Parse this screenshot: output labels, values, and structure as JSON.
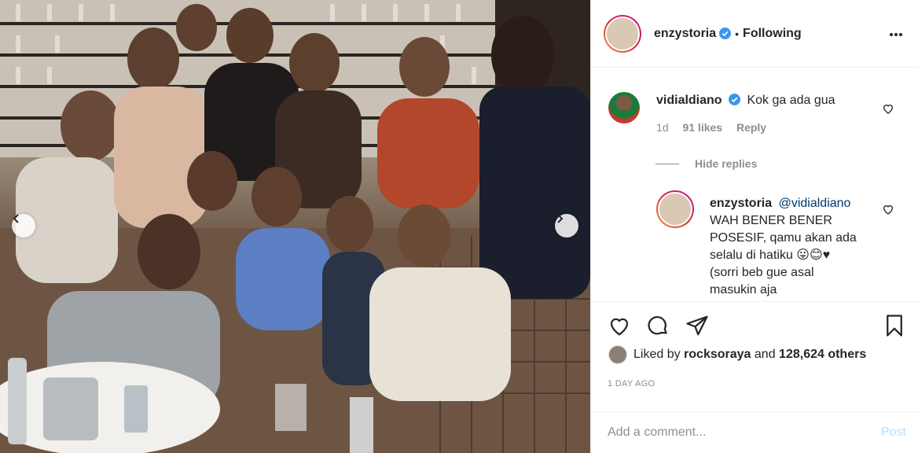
{
  "post": {
    "author": "enzystoria",
    "follow_state": "Following",
    "dot": "•"
  },
  "comments": [
    {
      "user": "vidialdiano",
      "text": "Kok ga ada gua",
      "age": "1d",
      "likes": "91 likes",
      "reply_label": "Reply"
    }
  ],
  "hide_replies_label": "Hide replies",
  "reply": {
    "user": "enzystoria",
    "mention": "@vidialdiano",
    "lines": [
      "WAH BENER BENER",
      "POSESIF, qamu akan ada",
      "selalu di hatiku 😛😊♥",
      "(sorri beb gue asal",
      "masukin aja"
    ]
  },
  "likes_line": {
    "prefix": "Liked by",
    "user": "rocksoraya",
    "middle": "and",
    "others": "128,624 others"
  },
  "timestamp": "1 DAY AGO",
  "add_comment": {
    "placeholder": "Add a comment...",
    "post_label": "Post"
  },
  "colors": {
    "verified": "#3897f0",
    "post_disabled": "#b2dffc",
    "muted": "#8e8e8e"
  },
  "icons": [
    "heart-icon",
    "comment-icon",
    "share-icon",
    "bookmark-icon",
    "more-icon",
    "chevron-left-icon",
    "chevron-right-icon",
    "verified-icon"
  ]
}
